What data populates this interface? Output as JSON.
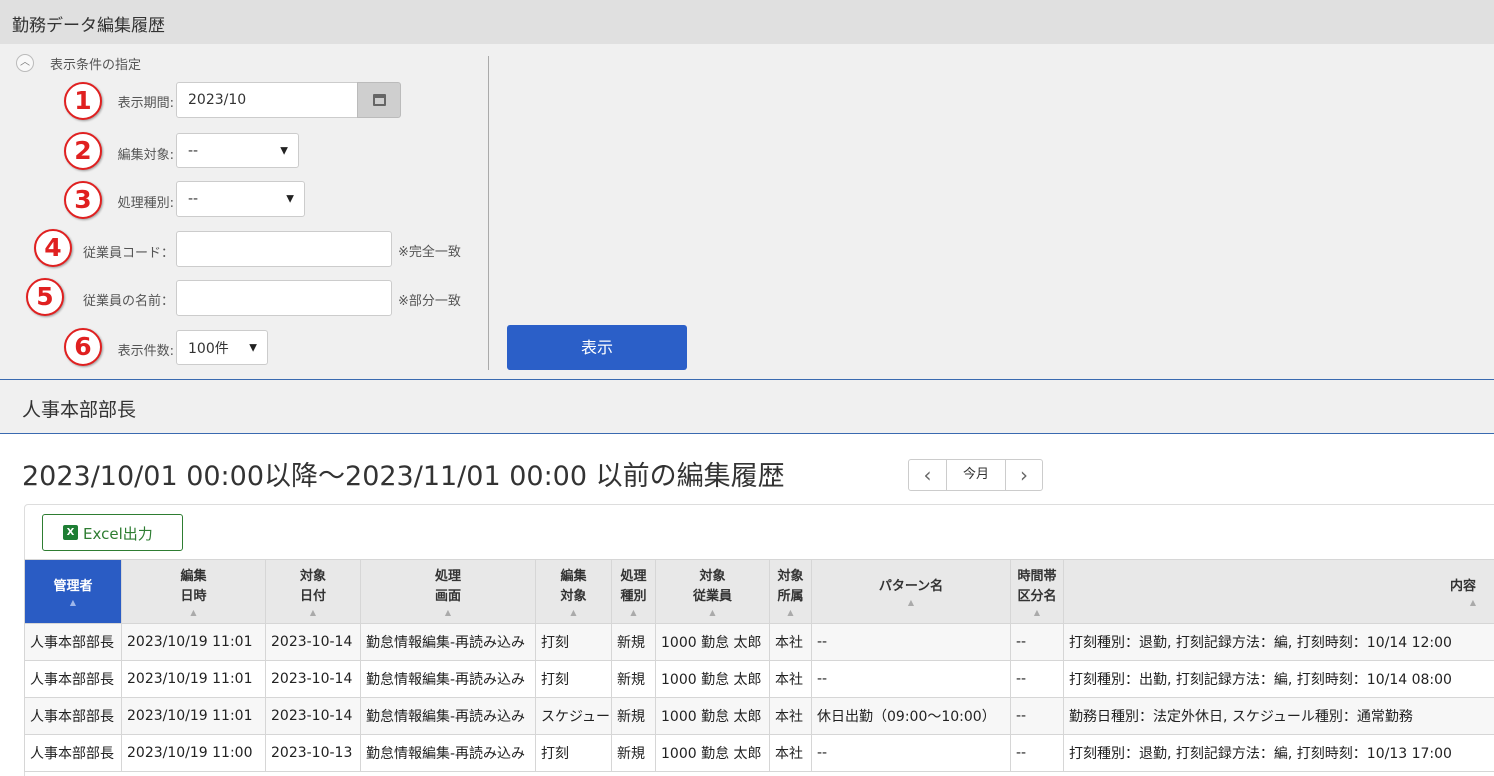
{
  "header": {
    "title": "勤務データ編集履歴"
  },
  "conditions": {
    "toggle_label": "表示条件の指定",
    "period": {
      "badge": "1",
      "label": "表示期間:",
      "value": "2023/10"
    },
    "edit_target": {
      "badge": "2",
      "label": "編集対象:",
      "value": "--"
    },
    "process_type": {
      "badge": "3",
      "label": "処理種別:",
      "value": "--"
    },
    "employee_code": {
      "badge": "4",
      "label": "従業員コード：",
      "value": "",
      "note": "※完全一致"
    },
    "employee_name": {
      "badge": "5",
      "label": "従業員の名前：",
      "value": "",
      "note": "※部分一致"
    },
    "count": {
      "badge": "6",
      "label": "表示件数:",
      "value": "100件"
    },
    "show_button": "表示"
  },
  "section": {
    "title": "人事本部部長"
  },
  "history": {
    "range_title": "2023/10/01 00:00以降～2023/11/01 00:00 以前の編集履歴",
    "pager": {
      "prev": "‹",
      "current": "今月",
      "next": "›"
    },
    "excel_button": "Excel出力",
    "excel_icon": "X",
    "columns": [
      {
        "l1": "管理者",
        "l2": ""
      },
      {
        "l1": "編集",
        "l2": "日時"
      },
      {
        "l1": "対象",
        "l2": "日付"
      },
      {
        "l1": "処理",
        "l2": "画面"
      },
      {
        "l1": "編集",
        "l2": "対象"
      },
      {
        "l1": "処理",
        "l2": "種別"
      },
      {
        "l1": "対象",
        "l2": "従業員"
      },
      {
        "l1": "対象",
        "l2": "所属"
      },
      {
        "l1": "パターン名",
        "l2": ""
      },
      {
        "l1": "時間帯",
        "l2": "区分名"
      },
      {
        "l1": "内容",
        "l2": ""
      }
    ],
    "rows": [
      [
        "人事本部部長",
        "2023/10/19 11:01",
        "2023-10-14",
        "勤怠情報編集-再読み込み",
        "打刻",
        "新規",
        "1000 勤怠 太郎",
        "本社",
        "--",
        "--",
        "打刻種別：退勤, 打刻記録方法：編, 打刻時刻：10/14 12:00"
      ],
      [
        "人事本部部長",
        "2023/10/19 11:01",
        "2023-10-14",
        "勤怠情報編集-再読み込み",
        "打刻",
        "新規",
        "1000 勤怠 太郎",
        "本社",
        "--",
        "--",
        "打刻種別：出勤, 打刻記録方法：編, 打刻時刻：10/14 08:00"
      ],
      [
        "人事本部部長",
        "2023/10/19 11:01",
        "2023-10-14",
        "勤怠情報編集-再読み込み",
        "スケジュール",
        "新規",
        "1000 勤怠 太郎",
        "本社",
        "休日出勤（09:00～10:00）",
        "--",
        "勤務日種別：法定外休日, スケジュール種別：通常勤務"
      ],
      [
        "人事本部部長",
        "2023/10/19 11:00",
        "2023-10-13",
        "勤怠情報編集-再読み込み",
        "打刻",
        "新規",
        "1000 勤怠 太郎",
        "本社",
        "--",
        "--",
        "打刻種別：退勤, 打刻記録方法：編, 打刻時刻：10/13 17:00"
      ]
    ]
  }
}
